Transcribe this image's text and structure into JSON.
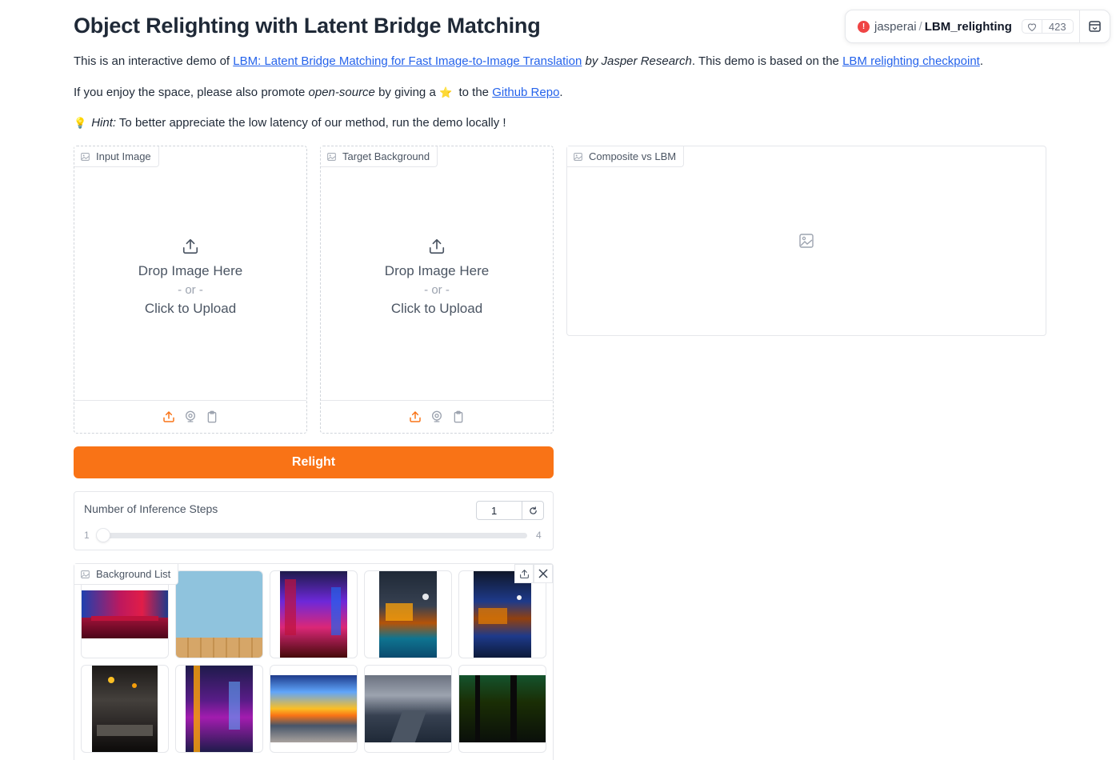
{
  "space": {
    "owner": "jasperai",
    "separator": "/",
    "repo": "LBM_relighting",
    "likes": "423"
  },
  "title": "Object Relighting with Latent Bridge Matching",
  "intro": {
    "prefix": "This is an interactive demo of ",
    "paper_link": "LBM: Latent Bridge Matching for Fast Image-to-Image Translation",
    "by": " by ",
    "author": "Jasper Research",
    "middle": ". This demo is based on the ",
    "checkpoint_link": "LBM relighting checkpoint",
    "suffix": "."
  },
  "promo": {
    "prefix": "If you enjoy the space, please also promote ",
    "emph": "open-source",
    "middle": " by giving a ",
    "star": "⭐",
    "middle2": "  to the ",
    "link": "Github Repo",
    "suffix": "."
  },
  "hint": {
    "icon": "💡",
    "label": "Hint:",
    "text": " To better appreciate the low latency of our method, run the demo locally !"
  },
  "input_image": {
    "label": "Input Image",
    "drop": "Drop Image Here",
    "or": "- or -",
    "click": "Click to Upload"
  },
  "target_background": {
    "label": "Target Background",
    "drop": "Drop Image Here",
    "or": "- or -",
    "click": "Click to Upload"
  },
  "composite": {
    "label": "Composite vs LBM"
  },
  "relight_button": "Relight",
  "steps": {
    "label": "Number of Inference Steps",
    "value": "1",
    "min": "1",
    "max": "4",
    "fraction": 0.0
  },
  "background_list": {
    "label": "Background List",
    "items": [
      "pink-blue-table",
      "blue-wall-wood",
      "neon-city-street",
      "pool-villa-night",
      "tropical-pool-moon",
      "dark-restaurant",
      "neon-alley",
      "sunset-beach",
      "foggy-road",
      "dark-forest"
    ]
  },
  "colors": {
    "accent": "#f97316",
    "link": "#2563eb"
  }
}
